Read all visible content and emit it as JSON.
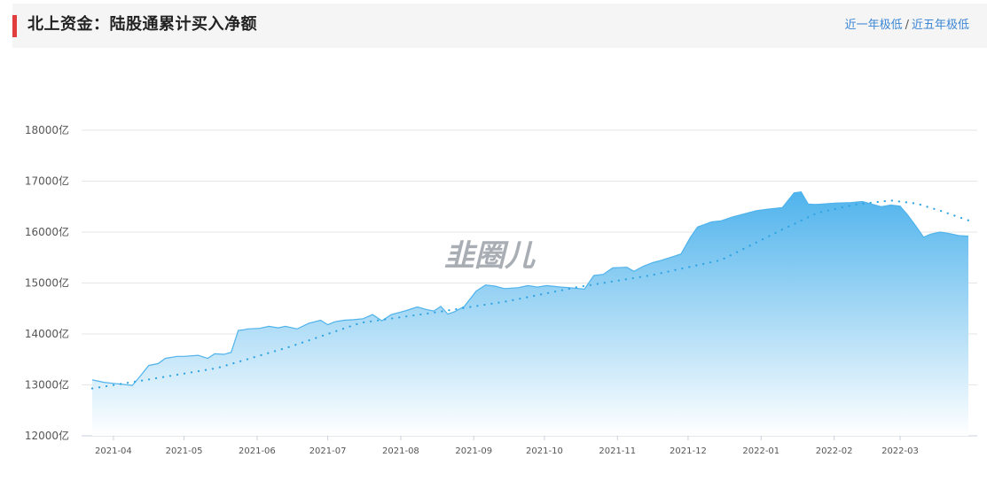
{
  "header": {
    "title": "北上资金：陆股通累计买入净额",
    "link_year": "近一年极低",
    "link_sep": "/",
    "link_five": "近五年极低"
  },
  "watermark": "韭圈儿",
  "colors": {
    "accent_red": "#e23d3d",
    "line": "#4fb3ec",
    "fill_top": "#4fb3ec",
    "fill_bottom": "#ffffff",
    "trend": "#2ea3e3",
    "link": "#3b86d4"
  },
  "chart_data": {
    "type": "area",
    "ylim": [
      12000,
      18000
    ],
    "y_ticks": [
      12000,
      13000,
      14000,
      15000,
      16000,
      17000,
      18000
    ],
    "y_tick_labels": [
      "12000亿",
      "13000亿",
      "14000亿",
      "15000亿",
      "16000亿",
      "17000亿",
      "18000亿"
    ],
    "x_tick_labels": [
      "2021-04",
      "2021-05",
      "2021-06",
      "2021-07",
      "2021-08",
      "2021-09",
      "2021-10",
      "2021-11",
      "2021-12",
      "2022-01",
      "2022-02",
      "2022-03"
    ],
    "x_tick_dates": [
      "2021-04-01",
      "2021-05-01",
      "2021-06-01",
      "2021-07-01",
      "2021-08-01",
      "2021-09-01",
      "2021-10-01",
      "2021-11-01",
      "2021-12-01",
      "2022-01-01",
      "2022-02-01",
      "2022-03-01"
    ],
    "xlim": [
      "2021-03-23",
      "2022-03-30"
    ],
    "grid": true,
    "series": [
      {
        "style": "area",
        "x": [
          "2021-03-23",
          "2021-03-26",
          "2021-03-28",
          "2021-04-01",
          "2021-04-05",
          "2021-04-09",
          "2021-04-12",
          "2021-04-16",
          "2021-04-20",
          "2021-04-23",
          "2021-04-28",
          "2021-05-01",
          "2021-05-07",
          "2021-05-11",
          "2021-05-14",
          "2021-05-18",
          "2021-05-21",
          "2021-05-24",
          "2021-05-26",
          "2021-05-28",
          "2021-06-02",
          "2021-06-06",
          "2021-06-10",
          "2021-06-13",
          "2021-06-18",
          "2021-06-23",
          "2021-06-28",
          "2021-07-01",
          "2021-07-04",
          "2021-07-08",
          "2021-07-12",
          "2021-07-16",
          "2021-07-20",
          "2021-07-24",
          "2021-07-28",
          "2021-08-01",
          "2021-08-04",
          "2021-08-08",
          "2021-08-12",
          "2021-08-15",
          "2021-08-18",
          "2021-08-21",
          "2021-08-24",
          "2021-08-28",
          "2021-09-02",
          "2021-09-06",
          "2021-09-10",
          "2021-09-14",
          "2021-09-20",
          "2021-09-24",
          "2021-09-28",
          "2021-10-02",
          "2021-10-08",
          "2021-10-14",
          "2021-10-18",
          "2021-10-22",
          "2021-10-26",
          "2021-10-30",
          "2021-11-05",
          "2021-11-08",
          "2021-11-12",
          "2021-11-16",
          "2021-11-20",
          "2021-11-24",
          "2021-11-28",
          "2021-12-02",
          "2021-12-05",
          "2021-12-08",
          "2021-12-11",
          "2021-12-15",
          "2021-12-20",
          "2021-12-25",
          "2021-12-30",
          "2022-01-04",
          "2022-01-10",
          "2022-01-15",
          "2022-01-18",
          "2022-01-21",
          "2022-01-24",
          "2022-01-27",
          "2022-02-02",
          "2022-02-08",
          "2022-02-13",
          "2022-02-17",
          "2022-02-21",
          "2022-02-25",
          "2022-03-01",
          "2022-03-04",
          "2022-03-08",
          "2022-03-11",
          "2022-03-14",
          "2022-03-18",
          "2022-03-22",
          "2022-03-26",
          "2022-03-30"
        ],
        "y": [
          13100,
          13070,
          13050,
          13030,
          13010,
          12990,
          13150,
          13380,
          13420,
          13520,
          13560,
          13560,
          13580,
          13520,
          13610,
          13600,
          13640,
          14070,
          14080,
          14100,
          14110,
          14150,
          14120,
          14150,
          14100,
          14210,
          14270,
          14180,
          14240,
          14270,
          14280,
          14300,
          14380,
          14260,
          14380,
          14430,
          14470,
          14530,
          14480,
          14450,
          14540,
          14390,
          14440,
          14540,
          14840,
          14960,
          14940,
          14890,
          14910,
          14950,
          14920,
          14950,
          14920,
          14900,
          14880,
          15150,
          15170,
          15300,
          15310,
          15230,
          15330,
          15400,
          15450,
          15510,
          15570,
          15900,
          16100,
          16150,
          16200,
          16220,
          16300,
          16360,
          16420,
          16450,
          16480,
          16770,
          16790,
          16550,
          16540,
          16550,
          16570,
          16580,
          16600,
          16550,
          16500,
          16530,
          16510,
          16350,
          16100,
          15900,
          15960,
          16000,
          15970,
          15930,
          15920
        ]
      },
      {
        "style": "dotted-trend",
        "x": [
          "2021-03-23",
          "2021-04-15",
          "2021-05-15",
          "2021-06-15",
          "2021-07-15",
          "2021-08-15",
          "2021-09-15",
          "2021-10-15",
          "2021-11-15",
          "2021-12-15",
          "2022-01-10",
          "2022-01-25",
          "2022-02-10",
          "2022-02-25",
          "2022-03-08",
          "2022-03-18",
          "2022-03-30"
        ],
        "y": [
          12930,
          13100,
          13330,
          13750,
          14220,
          14420,
          14640,
          14920,
          15150,
          15450,
          16050,
          16380,
          16540,
          16620,
          16560,
          16420,
          16230
        ]
      }
    ]
  }
}
